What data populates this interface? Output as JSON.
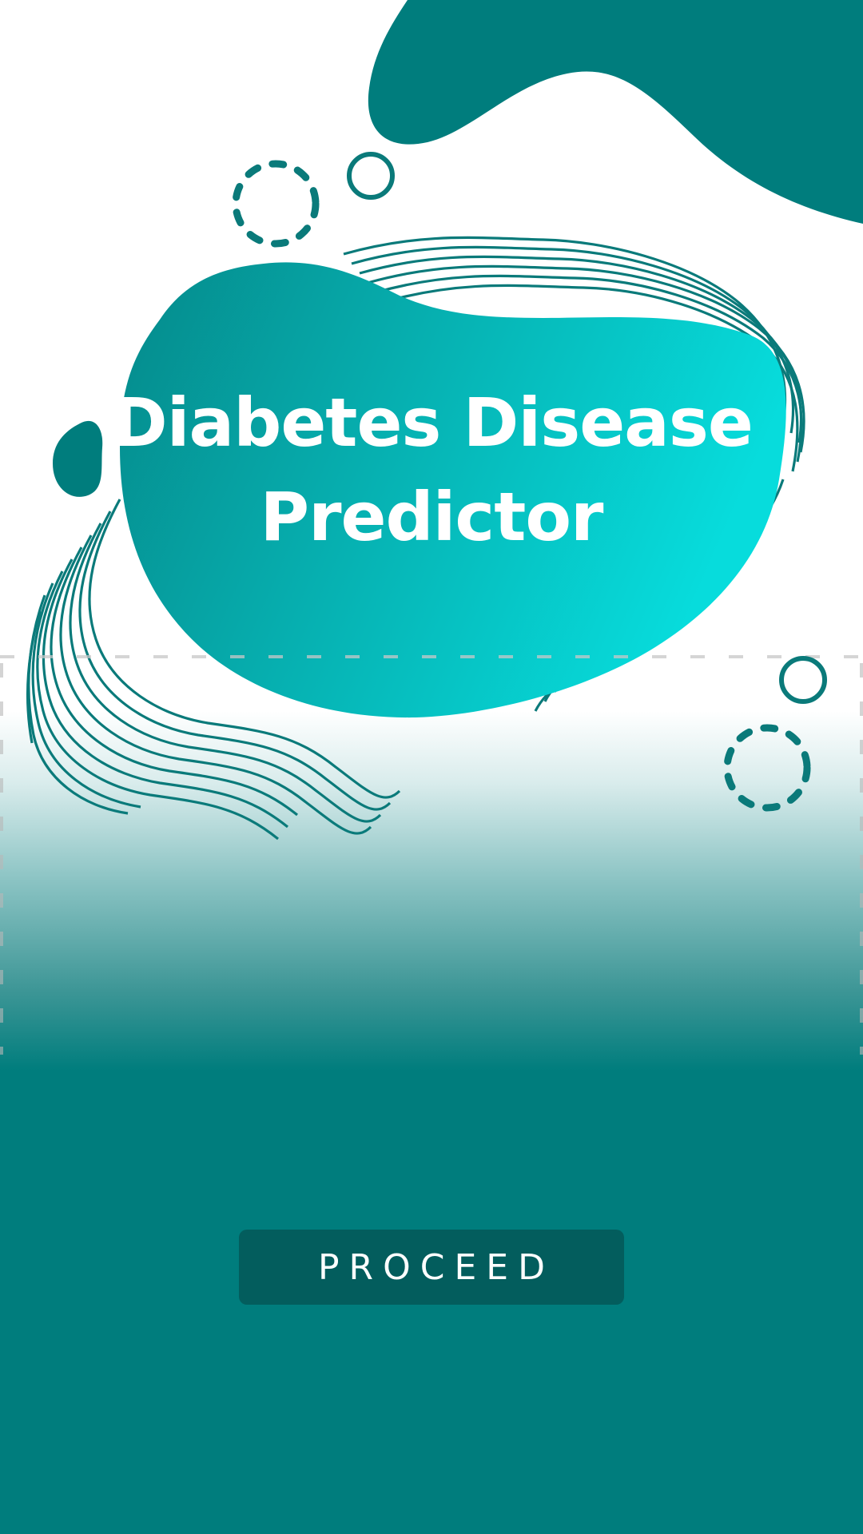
{
  "app": {
    "title_line1": "Diabetes Disease",
    "title_line2": "Predictor"
  },
  "actions": {
    "proceed_label": "PROCEED"
  },
  "colors": {
    "primary": "#007d7d",
    "button": "#035d5d",
    "blob_gradient_start": "#05898a",
    "blob_gradient_end": "#07dcdc",
    "background_top": "#ffffff"
  },
  "icons": {
    "decor": [
      "wave-pattern",
      "dashed-circle",
      "ring",
      "blob"
    ]
  }
}
